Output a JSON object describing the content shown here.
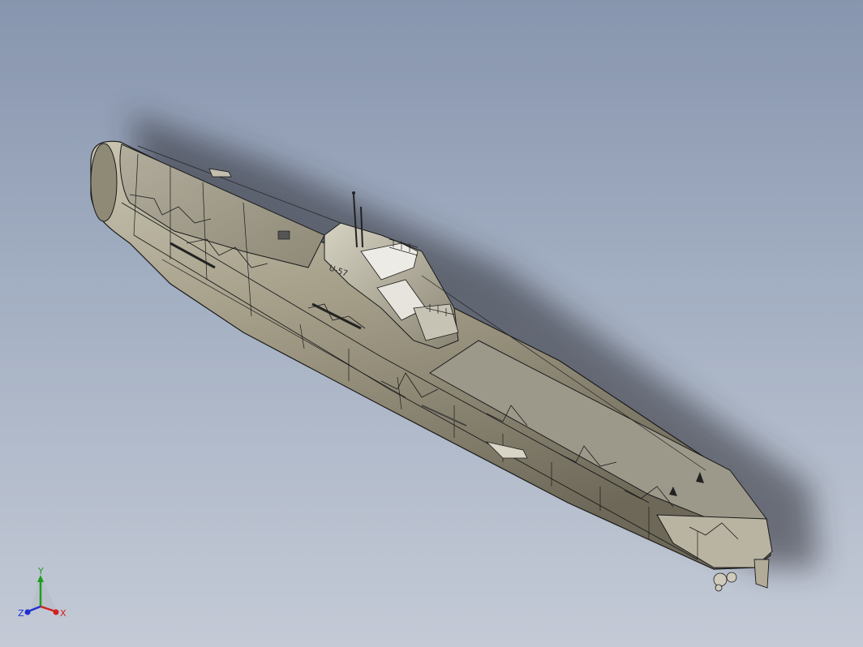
{
  "viewport": {
    "background_top": "#8795ae",
    "background_bottom": "#c4cad6"
  },
  "model": {
    "icon": "submarine-model",
    "hull_color": "#a19b86",
    "deck_color": "#9e9a8a",
    "edge_color": "#1a1a1a",
    "hull_marking": "U-57"
  },
  "triad": {
    "icon": "coordinate-triad-icon",
    "x_label": "X",
    "y_label": "Y",
    "z_label": "Z",
    "x_color": "#d42020",
    "y_color": "#1e9e1e",
    "z_color": "#2030d0"
  }
}
